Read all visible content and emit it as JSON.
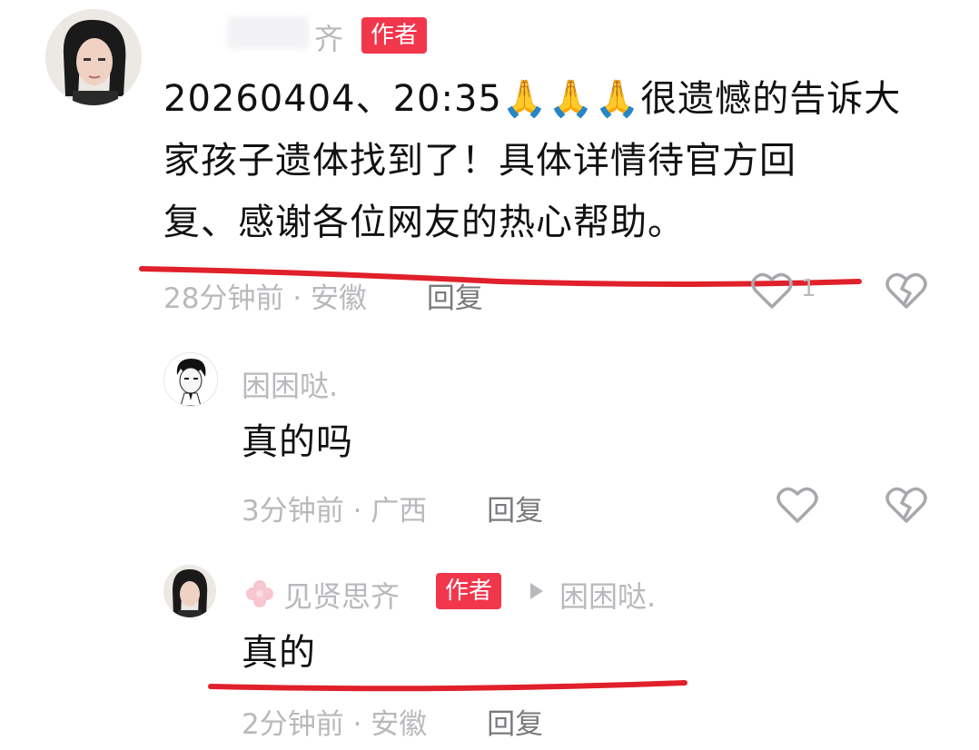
{
  "comment": {
    "author_name_visible": "齐",
    "author_badge": "作者",
    "text_line1": "20260404、20:35🙏🙏🙏很遗憾的告诉大",
    "text_line2": "家孩子遗体找到了！具体详情待官方回",
    "text_line3": "复、感谢各位网友的热心帮助。",
    "time_location": "28分钟前 · 安徽",
    "reply_label": "回复",
    "like_count": "1"
  },
  "replies": [
    {
      "author_name": "困困哒.",
      "text": "真的吗",
      "time_location": "3分钟前 · 广西",
      "reply_label": "回复"
    },
    {
      "author_name": "见贤思齐",
      "author_badge": "作者",
      "reply_to": "困困哒.",
      "text": "真的",
      "time_location": "2分钟前 · 安徽",
      "reply_label": "回复"
    }
  ],
  "colors": {
    "badge": "#f2364c",
    "annotation_line": "#e0202a",
    "secondary_text": "#b9b9bd"
  }
}
